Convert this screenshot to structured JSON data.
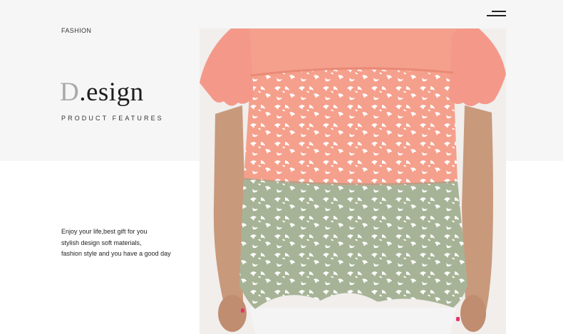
{
  "header": {
    "menu_icon": "hamburger-menu-icon"
  },
  "intro": {
    "section_label": "FASHION",
    "title_initial": "D",
    "title_rest": ".esign",
    "subtitle": "PRODUCT FEATURES"
  },
  "description": {
    "lines": [
      "Enjoy your life,best gift for you",
      "stylish design soft materials,",
      "fashion style and you have a good day"
    ]
  },
  "product_image": {
    "subject": "peplum-top-photo",
    "colors": {
      "pink": "#f5a08c",
      "sage": "#a7b396",
      "print": "#ffffff",
      "skin": "#c9997c"
    }
  }
}
